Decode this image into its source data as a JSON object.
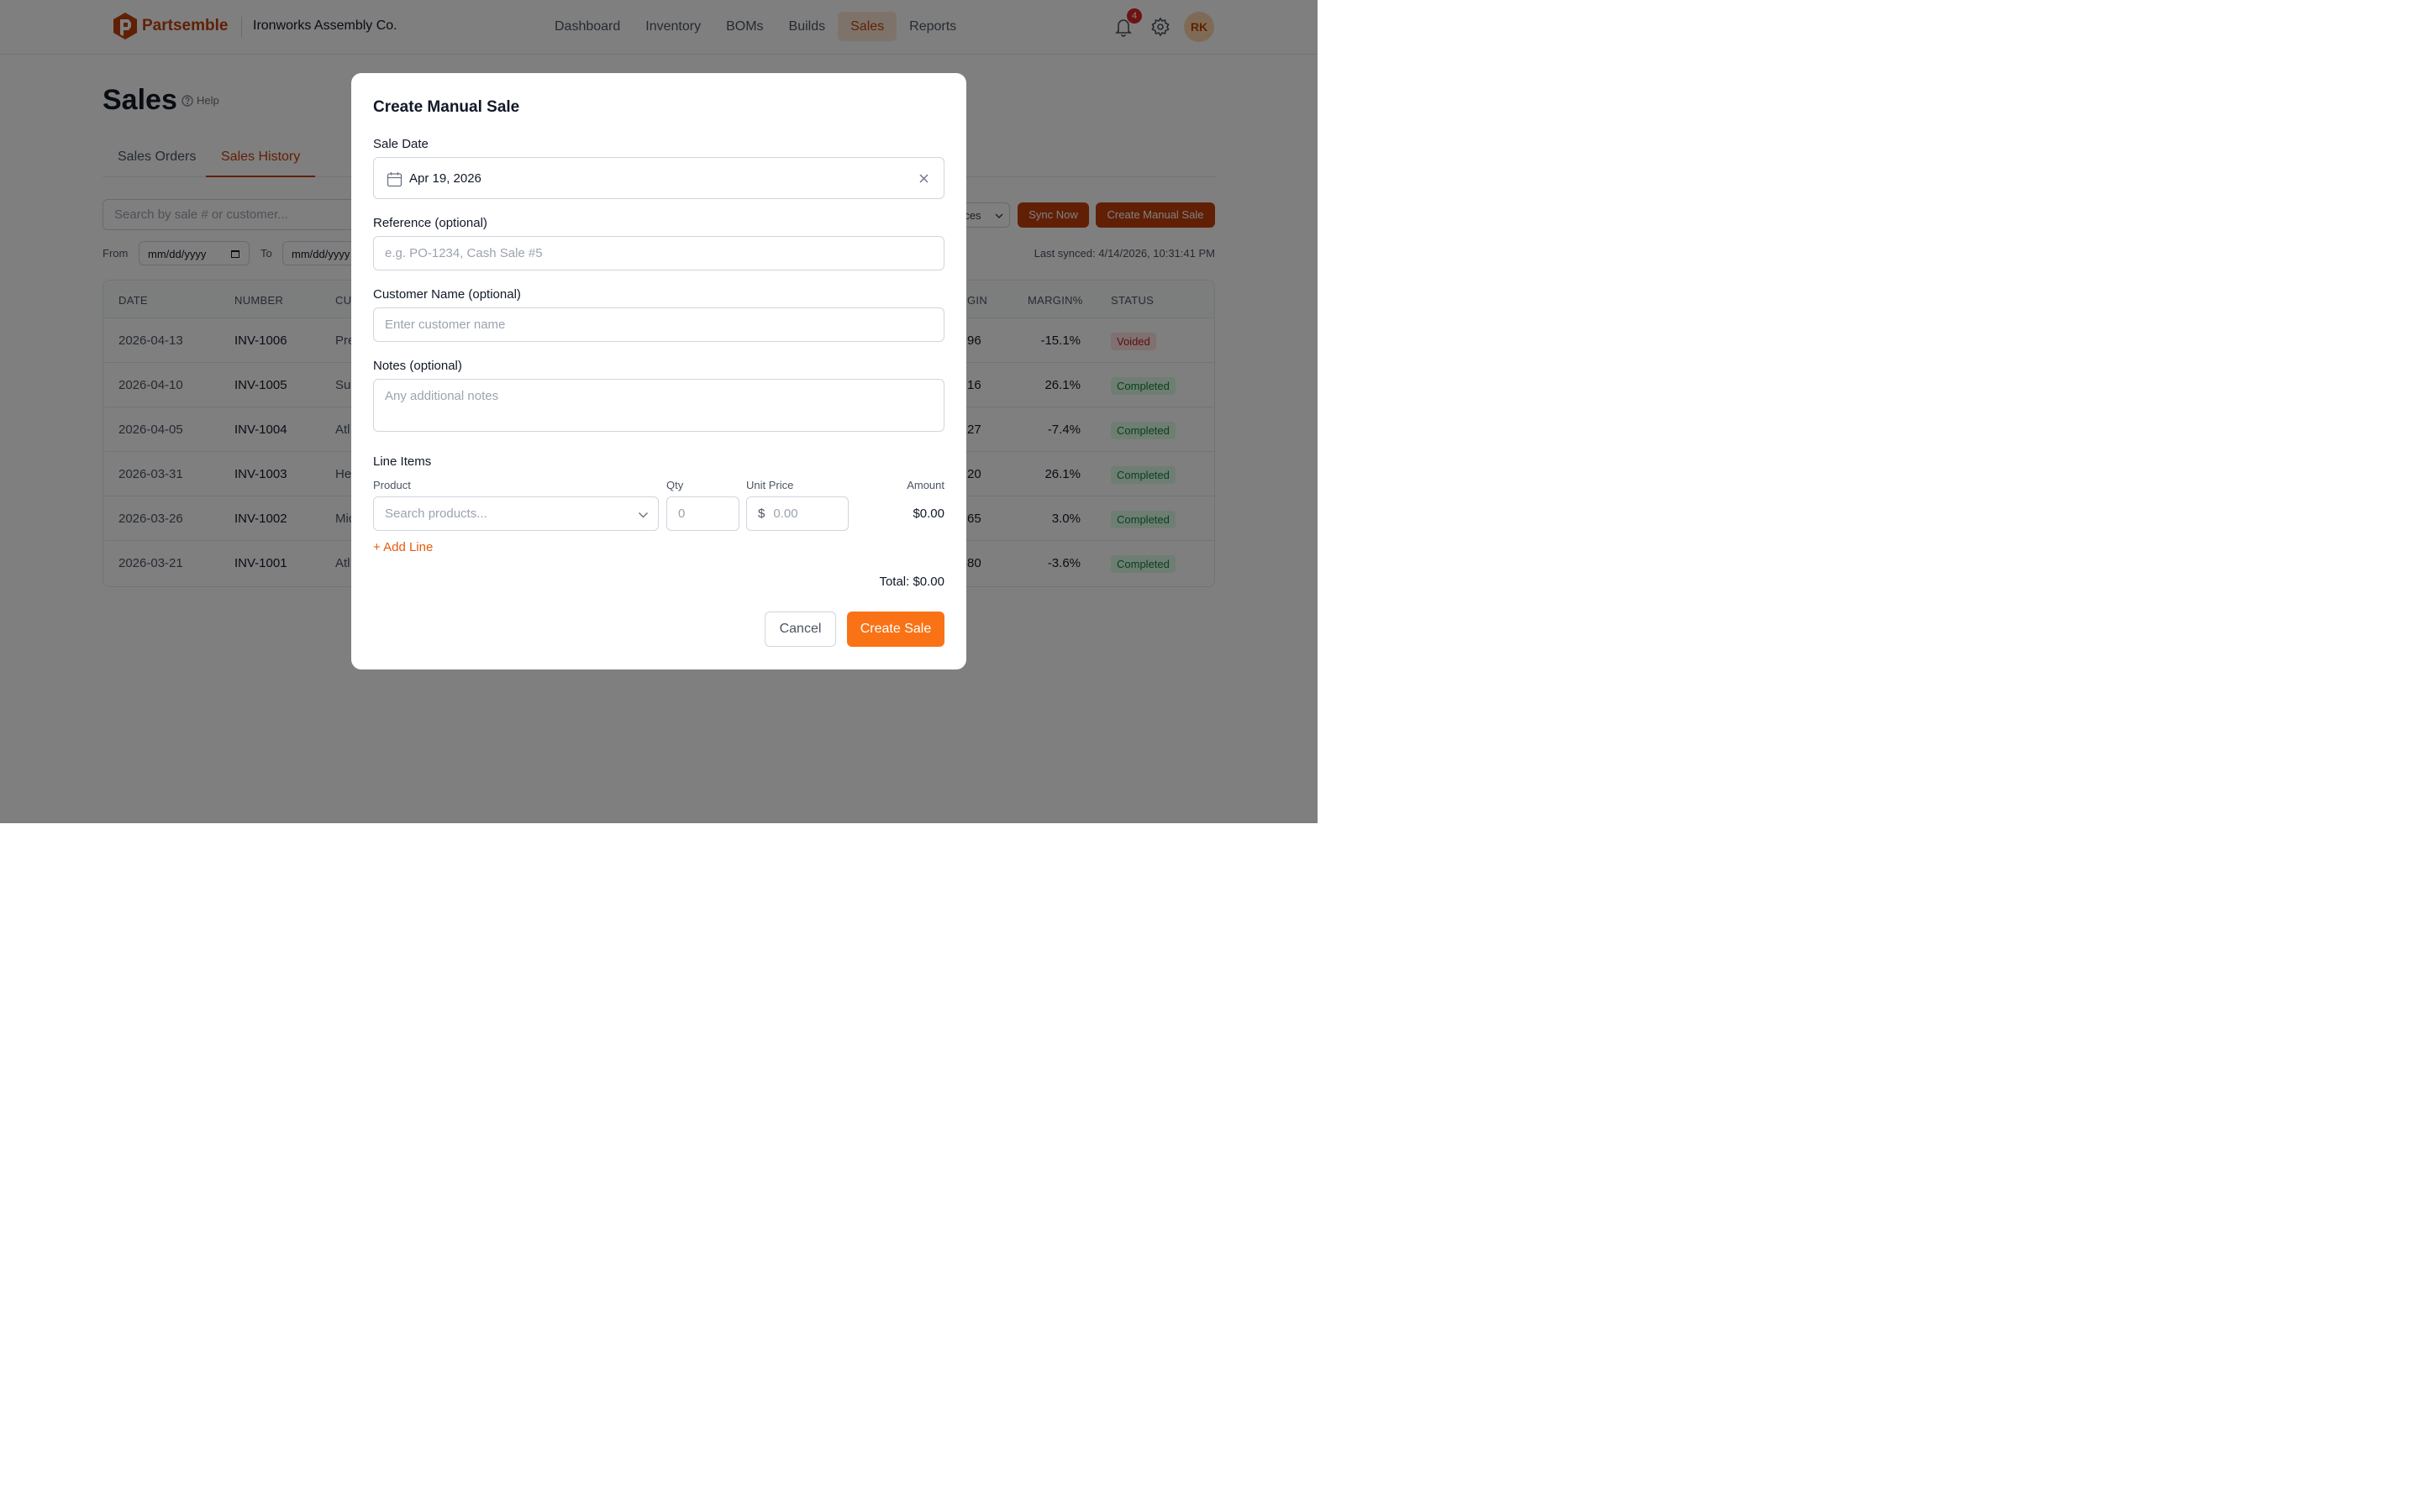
{
  "brand": {
    "name": "Partsemble",
    "company": "Ironworks Assembly Co."
  },
  "nav": [
    {
      "label": "Dashboard"
    },
    {
      "label": "Inventory"
    },
    {
      "label": "BOMs"
    },
    {
      "label": "Builds"
    },
    {
      "label": "Sales",
      "active": true
    },
    {
      "label": "Reports"
    }
  ],
  "header": {
    "notification_count": "4",
    "avatar_initials": "RK"
  },
  "page": {
    "title": "Sales",
    "help_label": "Help"
  },
  "tabs": [
    {
      "label": "Sales Orders"
    },
    {
      "label": "Sales History",
      "active": true
    }
  ],
  "toolbar": {
    "search_placeholder": "Search by sale # or customer...",
    "sources_label": "rces",
    "sync_label": "Sync Now",
    "create_label": "Create Manual Sale",
    "from_label": "From",
    "to_label": "To",
    "from_value": "mm/dd/yyyy",
    "to_value": "mm/dd/yyyy",
    "last_synced": "Last synced: 4/14/2026, 10:31:41 PM"
  },
  "table": {
    "columns": [
      "DATE",
      "NUMBER",
      "CU",
      "GIN",
      "MARGIN%",
      "STATUS"
    ],
    "rows": [
      {
        "date": "2026-04-13",
        "number": "INV-1006",
        "customer": "Pre",
        "margin": "96",
        "margin_pct": "-15.1%",
        "status": "Voided"
      },
      {
        "date": "2026-04-10",
        "number": "INV-1005",
        "customer": "Su",
        "margin": "16",
        "margin_pct": "26.1%",
        "status": "Completed"
      },
      {
        "date": "2026-04-05",
        "number": "INV-1004",
        "customer": "Atl",
        "margin": "27",
        "margin_pct": "-7.4%",
        "status": "Completed"
      },
      {
        "date": "2026-03-31",
        "number": "INV-1003",
        "customer": "He",
        "margin": "20",
        "margin_pct": "26.1%",
        "status": "Completed"
      },
      {
        "date": "2026-03-26",
        "number": "INV-1002",
        "customer": "Mic",
        "margin": "65",
        "margin_pct": "3.0%",
        "status": "Completed"
      },
      {
        "date": "2026-03-21",
        "number": "INV-1001",
        "customer": "Atl",
        "margin": "80",
        "margin_pct": "-3.6%",
        "status": "Completed"
      }
    ]
  },
  "modal": {
    "title": "Create Manual Sale",
    "sale_date_label": "Sale Date",
    "sale_date_value": "Apr 19, 2026",
    "reference_label": "Reference (optional)",
    "reference_placeholder": "e.g. PO-1234, Cash Sale #5",
    "customer_label": "Customer Name (optional)",
    "customer_placeholder": "Enter customer name",
    "notes_label": "Notes (optional)",
    "notes_placeholder": "Any additional notes",
    "line_items_label": "Line Items",
    "col_product": "Product",
    "col_qty": "Qty",
    "col_unit_price": "Unit Price",
    "col_amount": "Amount",
    "product_placeholder": "Search products...",
    "qty_placeholder": "0",
    "currency_symbol": "$",
    "price_placeholder": "0.00",
    "amount_value": "$0.00",
    "add_line_label": "+ Add Line",
    "total_label": "Total: $0.00",
    "cancel_label": "Cancel",
    "submit_label": "Create Sale"
  },
  "colors": {
    "brand": "#c2410c",
    "accent": "#f97316",
    "voided": "#b91c1c",
    "completed": "#15803d"
  }
}
